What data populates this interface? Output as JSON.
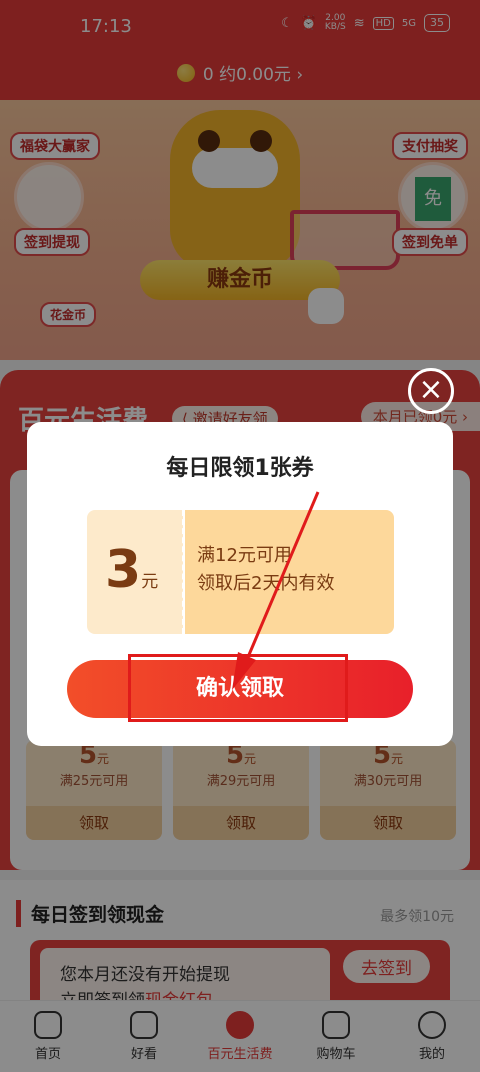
{
  "status": {
    "time": "17:13",
    "net_speed_top": "2.00",
    "net_speed_unit": "KB/S",
    "hd": "HD",
    "signal": "5G",
    "battery": "35"
  },
  "header": {
    "coin_text": "0 约0.00元 ›"
  },
  "banner": {
    "fudai": "福袋大赢家",
    "qiandao_tixian": "签到提现",
    "huajinbi": "花金币",
    "zhifu_choujiang": "支付抽奖",
    "qiandao_miandan": "签到免单",
    "mian_char": "免",
    "earn_button": "赚金币"
  },
  "section1": {
    "title": "百元生活费",
    "invite": "邀请好友领",
    "month_pill": "本月已领0元 ›",
    "coupons": [
      {
        "value": "5",
        "unit": "元",
        "cond": "满25元可用",
        "btn": "领取"
      },
      {
        "value": "5",
        "unit": "元",
        "cond": "满29元可用",
        "btn": "领取"
      },
      {
        "value": "5",
        "unit": "元",
        "cond": "满30元可用",
        "btn": "领取"
      }
    ]
  },
  "section2": {
    "title": "每日签到领现金",
    "right": "最多领10元",
    "line1": "您本月还没有开始提现",
    "line2_a": "立即签到领",
    "line2_b": "现金红包",
    "button": "去签到"
  },
  "dialog": {
    "title": "每日限领1张券",
    "amount": "3",
    "unit": "元",
    "condition": "满12元可用",
    "validity": "领取后2天内有效",
    "confirm": "确认领取",
    "close_symbol": "×"
  },
  "nav": [
    {
      "label": "首页"
    },
    {
      "label": "好看"
    },
    {
      "label": "百元生活费"
    },
    {
      "label": "购物车"
    },
    {
      "label": "我的"
    }
  ],
  "colors": {
    "brand_red": "#e53b3a",
    "coupon_light": "#fdeacb",
    "coupon_gold": "#fdd89b"
  }
}
